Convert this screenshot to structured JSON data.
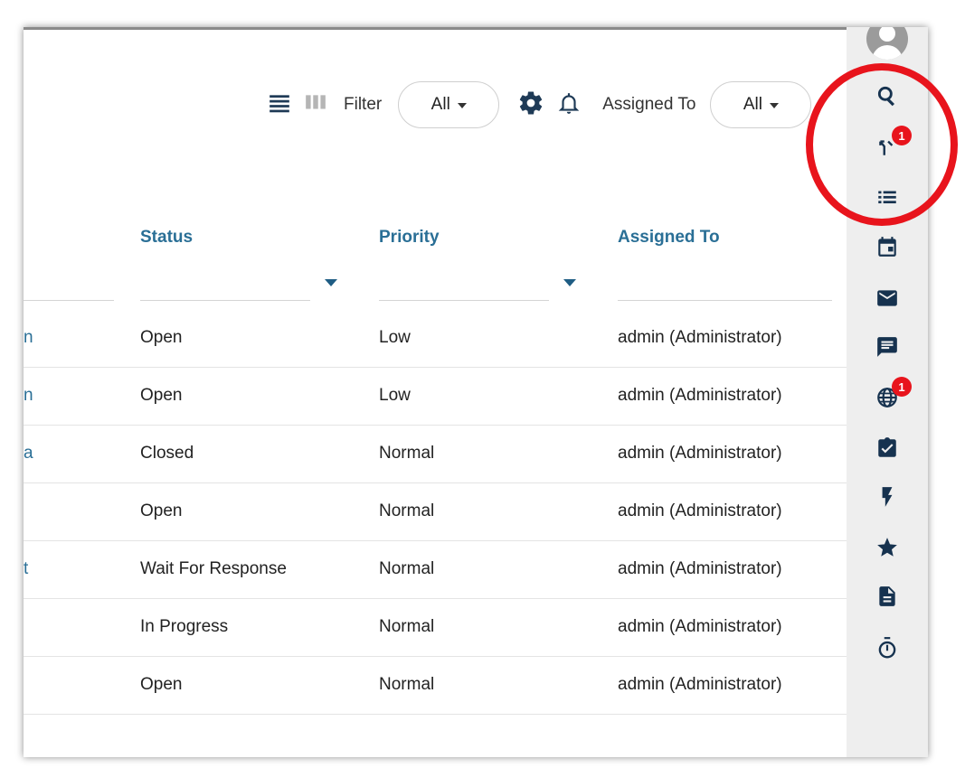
{
  "toolbar": {
    "filter_label": "Filter",
    "filter_value": "All",
    "assigned_label": "Assigned To",
    "assigned_value": "All"
  },
  "columns": [
    "Status",
    "Priority",
    "Assigned To"
  ],
  "rows": [
    {
      "cut": "n",
      "status": "Open",
      "priority": "Low",
      "assigned": "admin (Administrator)"
    },
    {
      "cut": "n",
      "status": "Open",
      "priority": "Low",
      "assigned": "admin (Administrator)"
    },
    {
      "cut": "a",
      "status": "Closed",
      "priority": "Normal",
      "assigned": "admin (Administrator)"
    },
    {
      "cut": "",
      "status": "Open",
      "priority": "Normal",
      "assigned": "admin (Administrator)"
    },
    {
      "cut": "t",
      "status": "Wait For Response",
      "priority": "Normal",
      "assigned": "admin (Administrator)"
    },
    {
      "cut": "",
      "status": "In Progress",
      "priority": "Normal",
      "assigned": "admin (Administrator)"
    },
    {
      "cut": "",
      "status": "Open",
      "priority": "Normal",
      "assigned": "admin (Administrator)"
    }
  ],
  "rail": {
    "items": [
      {
        "name": "search-icon"
      },
      {
        "name": "branch-icon",
        "badge": "1"
      },
      {
        "name": "list-icon"
      },
      {
        "name": "calendar-icon"
      },
      {
        "name": "mail-icon"
      },
      {
        "name": "chat-icon"
      },
      {
        "name": "globe-icon",
        "badge": "1"
      },
      {
        "name": "task-icon"
      },
      {
        "name": "lightning-icon"
      },
      {
        "name": "star-icon"
      },
      {
        "name": "document-icon"
      },
      {
        "name": "timer-icon"
      }
    ]
  },
  "colors": {
    "link": "#2a6f96",
    "icon_dark": "#16324f",
    "badge": "#e8141c",
    "annotation_circle": "#e8141c",
    "rail_bg": "#eeeeee"
  }
}
